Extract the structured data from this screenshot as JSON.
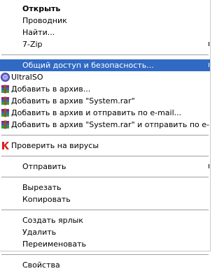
{
  "menu": {
    "items": [
      {
        "label": "Открыть",
        "bold": true
      },
      {
        "label": "Проводник"
      },
      {
        "label": "Найти..."
      },
      {
        "label": "7-Zip",
        "submenu": true
      },
      {
        "label": "Общий доступ и безопасность...",
        "highlighted": true,
        "submenu": true
      },
      {
        "label": "UltraISO",
        "icon": "ultraiso-icon"
      },
      {
        "label": "Добавить в архив...",
        "icon": "winrar-icon"
      },
      {
        "label": "Добавить в архив \"System.rar\"",
        "icon": "winrar-icon"
      },
      {
        "label": "Добавить в архив и отправить по e-mail...",
        "icon": "winrar-icon"
      },
      {
        "label": "Добавить в архив \"System.rar\" и отправить по e-mail",
        "icon": "winrar-icon"
      },
      {
        "label": "Проверить на вирусы",
        "icon": "kaspersky-icon"
      },
      {
        "label": "Отправить",
        "submenu": true
      },
      {
        "label": "Вырезать"
      },
      {
        "label": "Копировать"
      },
      {
        "label": "Создать ярлык"
      },
      {
        "label": "Удалить"
      },
      {
        "label": "Переименовать"
      },
      {
        "label": "Свойства"
      }
    ]
  },
  "colors": {
    "highlight_bg": "#316ac5",
    "highlight_fg": "#ffffff"
  }
}
